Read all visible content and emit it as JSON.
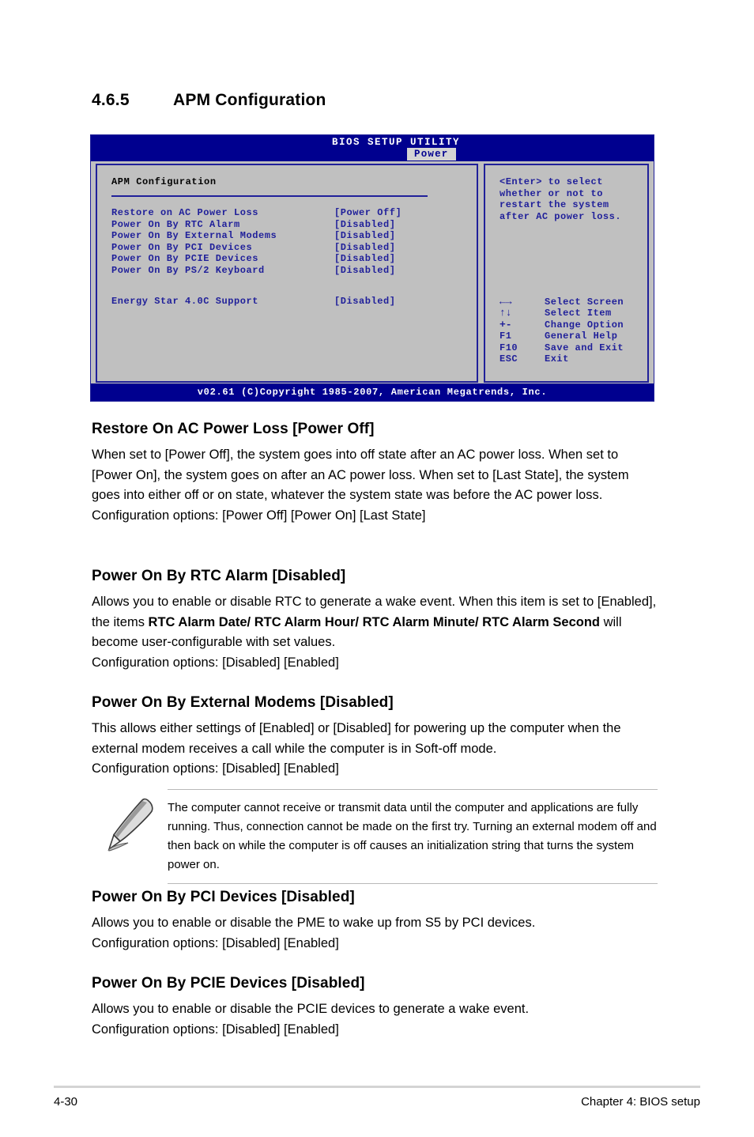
{
  "heading": {
    "number": "4.6.5",
    "title": "APM Configuration"
  },
  "bios": {
    "title": "BIOS SETUP UTILITY",
    "active_tab": "Power",
    "section_title": "APM Configuration",
    "options": [
      {
        "label": "Restore on AC Power Loss",
        "value": "[Power Off]"
      },
      {
        "label": "Power On By RTC Alarm",
        "value": "[Disabled]"
      },
      {
        "label": "Power On By External Modems",
        "value": "[Disabled]"
      },
      {
        "label": "Power On By PCI Devices",
        "value": "[Disabled]"
      },
      {
        "label": "Power On By PCIE Devices",
        "value": "[Disabled]"
      },
      {
        "label": "Power On By PS/2 Keyboard",
        "value": "[Disabled]"
      }
    ],
    "energy_star": {
      "label": "Energy Star 4.0C Support",
      "value": "[Disabled]"
    },
    "help": {
      "line1": "<Enter> to select",
      "line2": "whether or not to",
      "line3": "restart the system",
      "line4": "after AC power loss."
    },
    "legend": [
      {
        "key": "←→",
        "desc": "Select Screen",
        "symbol": true
      },
      {
        "key": "↑↓",
        "desc": "Select Item",
        "symbol": true
      },
      {
        "key": "+-",
        "desc": "Change Option",
        "symbol": true
      },
      {
        "key": "F1",
        "desc": "General Help",
        "symbol": false
      },
      {
        "key": "F10",
        "desc": "Save and Exit",
        "symbol": false
      },
      {
        "key": "ESC",
        "desc": "Exit",
        "symbol": false
      }
    ],
    "copyright": "v02.61 (C)Copyright 1985-2007, American Megatrends, Inc.",
    "colors": {
      "header_bg": "#00008f",
      "panel_bg": "#c0c0c0",
      "text_blue": "#20209a",
      "tab_bg": "#d4d4d4"
    }
  },
  "sections": {
    "restore": {
      "heading": "Restore On AC Power Loss [Power Off]",
      "body": "When set to [Power Off], the system goes into off state after an AC power loss. When set to [Power On], the system goes on after an AC power loss. When set to [Last State], the system goes into either off or on state, whatever the system state was before the AC power loss.",
      "config": "Configuration options: [Power Off] [Power On] [Last State]"
    },
    "rtc": {
      "heading": "Power On By RTC Alarm [Disabled]",
      "body_part1": "Allows you to enable or disable RTC to generate a wake event. When this item is set to [Enabled], the items ",
      "body_bold": "RTC Alarm Date/ RTC Alarm Hour/ RTC Alarm Minute/ RTC Alarm Second",
      "body_part2": " will become user-configurable with set values.",
      "config": "Configuration options: [Disabled] [Enabled]"
    },
    "modems": {
      "heading": "Power On By External Modems [Disabled]",
      "body": "This allows either settings of [Enabled] or [Disabled] for powering up the computer when the external modem receives a call while the computer is in Soft-off mode.",
      "config": "Configuration options: [Disabled] [Enabled]"
    },
    "note": {
      "text": "The computer cannot receive or transmit data until the computer and applications are fully running. Thus, connection cannot be made on the first try. Turning an external modem off and then back on while the computer is off causes an initialization string that turns the system power on."
    },
    "pci": {
      "heading": "Power On By PCI Devices [Disabled]",
      "body": "Allows you to enable or disable the PME to wake up from S5 by PCI devices.",
      "config": "Configuration options: [Disabled] [Enabled]"
    },
    "pcie": {
      "heading": "Power On By PCIE Devices [Disabled]",
      "body": "Allows you to enable or disable the PCIE devices to generate a wake event.",
      "config": "Configuration options: [Disabled] [Enabled]"
    }
  },
  "footer": {
    "page_number": "4-30",
    "chapter": "Chapter 4: BIOS setup"
  }
}
